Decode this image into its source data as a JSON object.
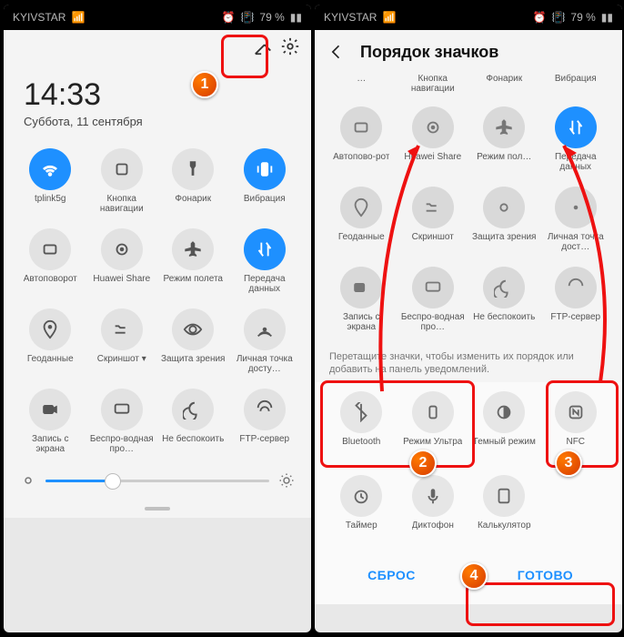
{
  "status": {
    "carrier": "KYIVSTAR",
    "battery": "79 %",
    "alarm": "⏰",
    "vib": "📳"
  },
  "left": {
    "clock": "14:33",
    "date": "Суббота, 11 сентября",
    "row1": [
      {
        "label": "tplink5g",
        "on": true
      },
      {
        "label": "Кнопка навигации"
      },
      {
        "label": "Фонарик"
      },
      {
        "label": "Вибрация",
        "on": true
      }
    ],
    "row2": [
      {
        "label": "Автоповорот"
      },
      {
        "label": "Huawei Share"
      },
      {
        "label": "Режим полета"
      },
      {
        "label": "Передача данных",
        "on": true
      }
    ],
    "row3": [
      {
        "label": "Геоданные"
      },
      {
        "label": "Скриншот ▾"
      },
      {
        "label": "Защита зрения"
      },
      {
        "label": "Личная точка досту…"
      }
    ],
    "row4": [
      {
        "label": "Запись с экрана"
      },
      {
        "label": "Беспро-водная про…"
      },
      {
        "label": "Не беспокоить"
      },
      {
        "label": "FTP-сервер"
      }
    ]
  },
  "right": {
    "title": "Порядок значков",
    "rowA": [
      {
        "label": "…"
      },
      {
        "label": "Кнопка навигации"
      },
      {
        "label": "Фонарик"
      },
      {
        "label": "Вибрация"
      }
    ],
    "rowB": [
      {
        "label": "Автопово-рот"
      },
      {
        "label": "Huawei Share"
      },
      {
        "label": "Режим пол…"
      },
      {
        "label": "Передача данных",
        "on": true
      }
    ],
    "rowC": [
      {
        "label": "Геоданные"
      },
      {
        "label": "Скриншот"
      },
      {
        "label": "Защита зрения"
      },
      {
        "label": "Личная точка дост…"
      }
    ],
    "rowD": [
      {
        "label": "Запись с экрана"
      },
      {
        "label": "Беспро-водная про…"
      },
      {
        "label": "Не беспокоить"
      },
      {
        "label": "FTP-сервер"
      }
    ],
    "hint": "Перетащите значки, чтобы изменить их порядок или добавить на панель уведомлений.",
    "extraA": [
      {
        "label": "Bluetooth"
      },
      {
        "label": "Режим Ультра"
      },
      {
        "label": "Темный режим"
      },
      {
        "label": "NFC"
      }
    ],
    "extraB": [
      {
        "label": "Таймер"
      },
      {
        "label": "Диктофон"
      },
      {
        "label": "Калькулятор"
      },
      {
        "label": ""
      }
    ],
    "reset": "СБРОС",
    "done": "ГОТОВО"
  },
  "ann": {
    "1": "1",
    "2": "2",
    "3": "3",
    "4": "4"
  }
}
